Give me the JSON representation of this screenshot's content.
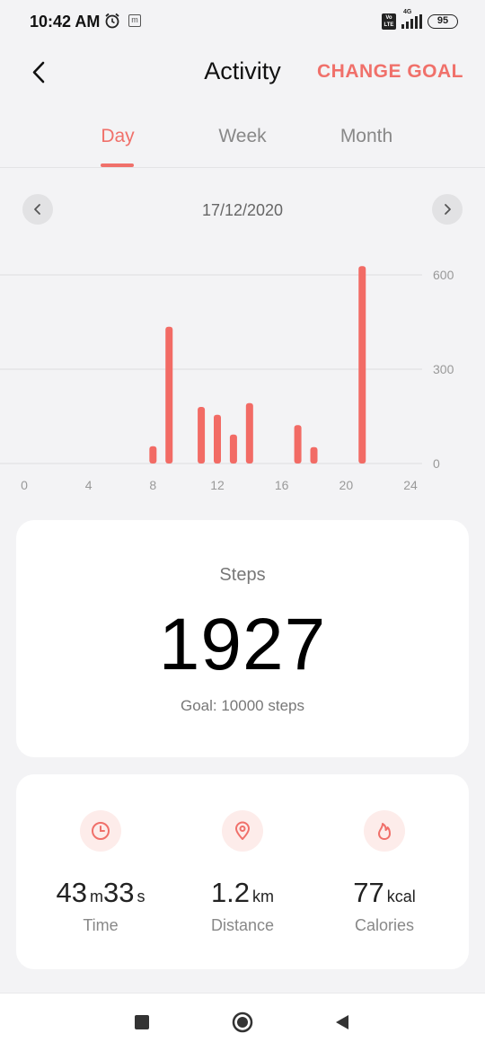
{
  "status_bar": {
    "time": "10:42 AM",
    "network": "4G",
    "battery": "95",
    "icons": [
      "alarm-icon",
      "m-notification-icon",
      "volte-icon",
      "signal-icon",
      "battery-icon"
    ]
  },
  "header": {
    "title": "Activity",
    "change_goal": "CHANGE GOAL"
  },
  "tabs": [
    {
      "label": "Day",
      "active": true
    },
    {
      "label": "Week",
      "active": false
    },
    {
      "label": "Month",
      "active": false
    }
  ],
  "date_nav": {
    "date": "17/12/2020"
  },
  "chart_data": {
    "type": "bar",
    "x_ticks": [
      "0",
      "4",
      "8",
      "12",
      "16",
      "20",
      "24"
    ],
    "y_ticks": [
      "0",
      "300",
      "600"
    ],
    "xlim": [
      0,
      24
    ],
    "ylim": [
      0,
      600
    ],
    "bar_color": "#f26b65",
    "bars": [
      {
        "x": 8,
        "value": 55
      },
      {
        "x": 9,
        "value": 435
      },
      {
        "x": 11,
        "value": 180
      },
      {
        "x": 12,
        "value": 155
      },
      {
        "x": 13,
        "value": 92
      },
      {
        "x": 14,
        "value": 192
      },
      {
        "x": 17,
        "value": 122
      },
      {
        "x": 18,
        "value": 52
      },
      {
        "x": 21,
        "value": 628
      }
    ]
  },
  "steps_card": {
    "label": "Steps",
    "value": "1927",
    "goal": "Goal: 10000 steps"
  },
  "stats": [
    {
      "icon": "clock-icon",
      "value_parts": [
        {
          "text": "43",
          "size": "big"
        },
        {
          "text": "m",
          "size": "unit"
        },
        {
          "text": "33",
          "size": "big"
        },
        {
          "text": "s",
          "size": "unit"
        }
      ],
      "label": "Time"
    },
    {
      "icon": "location-pin-icon",
      "value_parts": [
        {
          "text": "1.2",
          "size": "big"
        },
        {
          "text": "km",
          "size": "unit"
        }
      ],
      "label": "Distance"
    },
    {
      "icon": "flame-icon",
      "value_parts": [
        {
          "text": "77",
          "size": "big"
        },
        {
          "text": "kcal",
          "size": "unit"
        }
      ],
      "label": "Calories"
    }
  ],
  "colors": {
    "accent": "#f0706a",
    "background": "#f3f3f5",
    "card": "#ffffff"
  }
}
